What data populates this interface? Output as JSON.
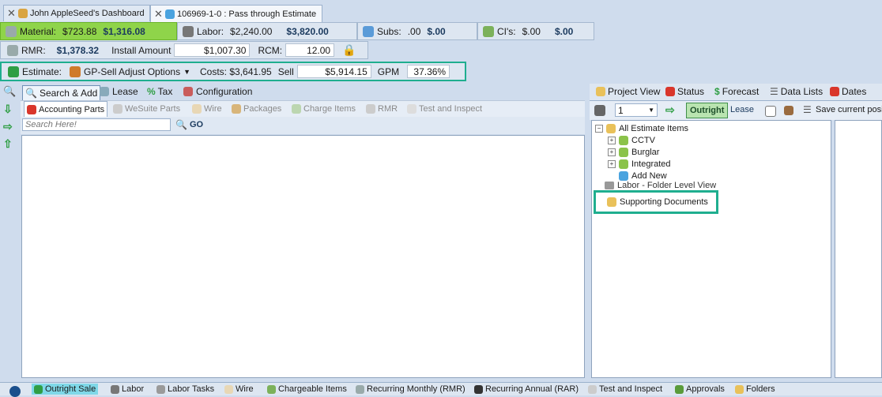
{
  "doc_tabs": [
    {
      "label": "John AppleSeed's Dashboard",
      "icon": "dashboard-icon"
    },
    {
      "label": "106969-1-0 : Pass through Estimate",
      "icon": "estimate-icon"
    }
  ],
  "totals": {
    "material_label": "Material:",
    "material_cost": "$723.88",
    "material_sell": "$1,316.08",
    "labor_label": "Labor:",
    "labor_cost": "$2,240.00",
    "labor_sell": "$3,820.00",
    "subs_label": "Subs:",
    "subs_cost": ".00",
    "subs_sell": "$.00",
    "cis_label": "CI's:",
    "cis_cost": "$.00",
    "cis_sell": "$.00",
    "rmr_label": "RMR:",
    "rmr_value": "$1,378.32",
    "install_label": "Install Amount",
    "install_value": "$1,007.30",
    "rcm_label": "RCM:",
    "rcm_value": "12.00",
    "estimate_label": "Estimate:",
    "gp_options": "GP-Sell Adjust Options",
    "costs_label": "Costs: $3,641.95",
    "sell_label": "Sell",
    "sell_value": "$5,914.15",
    "gpm_label": "GPM",
    "gpm_value": "37.36%"
  },
  "left_toolbar": {
    "search_add": "Search & Add",
    "lease": "Lease",
    "tax": "Tax",
    "configuration": "Configuration"
  },
  "parts_tabs": [
    "Accounting Parts",
    "WeSuite Parts",
    "Wire",
    "Packages",
    "Charge Items",
    "RMR",
    "Test and Inspect"
  ],
  "search": {
    "placeholder": "Search Here!",
    "go": "GO"
  },
  "right_tabs": [
    "Project View",
    "Status",
    "Forecast",
    "Data Lists",
    "Dates"
  ],
  "right_toolbar": {
    "select_value": "1",
    "outright": "Outright",
    "lease": "Lease",
    "save": "Save current positi"
  },
  "tree": {
    "root": "All Estimate Items",
    "children": [
      "CCTV",
      "Burglar",
      "Integrated",
      "Add New"
    ],
    "partial": "Labor - Folder Level View",
    "supporting": "Supporting Documents"
  },
  "bottom_tabs": [
    "Outright Sale",
    "Labor",
    "Labor Tasks",
    "Wire",
    "Chargeable Items",
    "Recurring Monthly (RMR)",
    "Recurring Annual (RAR)",
    "Test and Inspect",
    "Approvals",
    "Folders"
  ],
  "colors": {
    "material_green": "#8fd44a",
    "highlight_teal": "#1fae8f",
    "active_blue": "#b9d3ee"
  }
}
